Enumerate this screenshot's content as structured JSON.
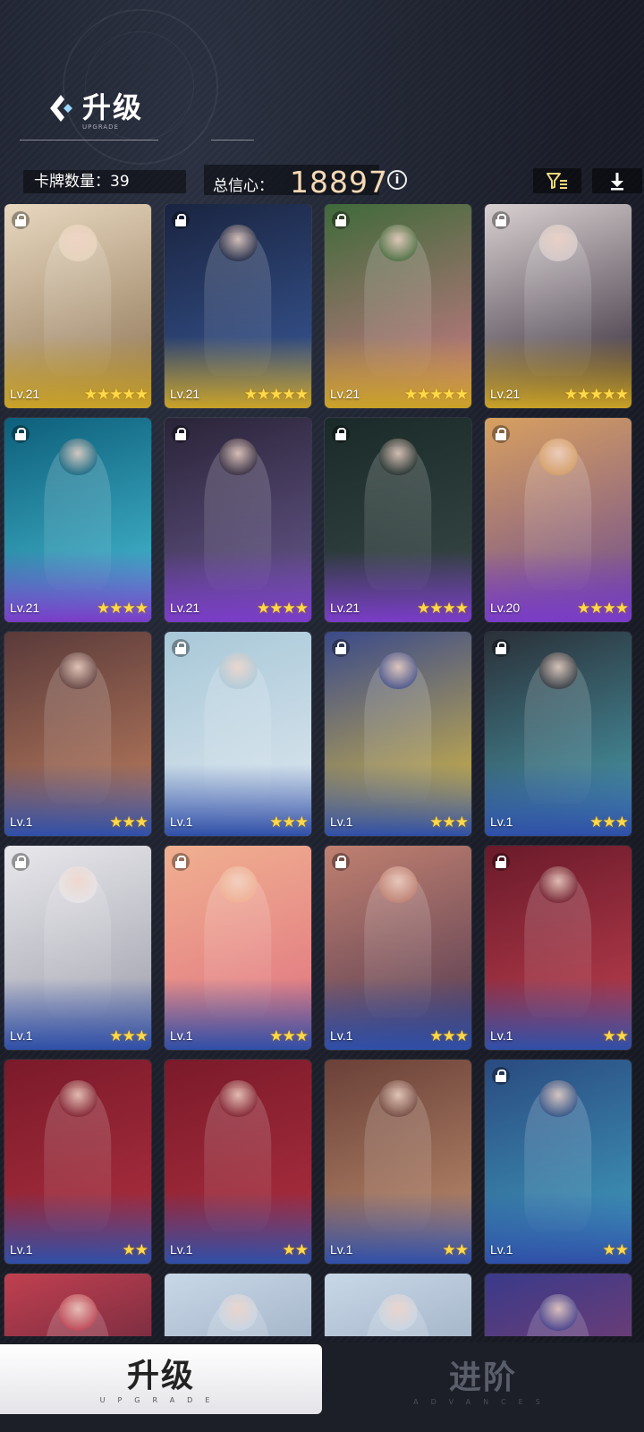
{
  "header": {
    "title": "升级",
    "subtitle": "UPGRADE"
  },
  "stats": {
    "card_count_label": "卡牌数量：",
    "card_count": "39",
    "total_label": "总信心：",
    "total_value": "18897"
  },
  "toolbar": {
    "info_icon": "info-icon",
    "filter_icon": "filter-icon",
    "download_icon": "download-icon"
  },
  "cards": [
    {
      "level": "Lv.21",
      "stars": 5,
      "locked": true
    },
    {
      "level": "Lv.21",
      "stars": 5,
      "locked": true
    },
    {
      "level": "Lv.21",
      "stars": 5,
      "locked": true
    },
    {
      "level": "Lv.21",
      "stars": 5,
      "locked": true
    },
    {
      "level": "Lv.21",
      "stars": 4,
      "locked": true
    },
    {
      "level": "Lv.21",
      "stars": 4,
      "locked": true
    },
    {
      "level": "Lv.21",
      "stars": 4,
      "locked": true
    },
    {
      "level": "Lv.20",
      "stars": 4,
      "locked": true
    },
    {
      "level": "Lv.1",
      "stars": 3,
      "locked": false
    },
    {
      "level": "Lv.1",
      "stars": 3,
      "locked": true
    },
    {
      "level": "Lv.1",
      "stars": 3,
      "locked": true
    },
    {
      "level": "Lv.1",
      "stars": 3,
      "locked": true
    },
    {
      "level": "Lv.1",
      "stars": 3,
      "locked": true
    },
    {
      "level": "Lv.1",
      "stars": 3,
      "locked": true
    },
    {
      "level": "Lv.1",
      "stars": 3,
      "locked": true
    },
    {
      "level": "Lv.1",
      "stars": 2,
      "locked": true
    },
    {
      "level": "Lv.1",
      "stars": 2,
      "locked": false
    },
    {
      "level": "Lv.1",
      "stars": 2,
      "locked": false
    },
    {
      "level": "Lv.1",
      "stars": 2,
      "locked": false
    },
    {
      "level": "Lv.1",
      "stars": 2,
      "locked": true
    },
    {
      "level": "",
      "stars": 0,
      "locked": false
    },
    {
      "level": "",
      "stars": 0,
      "locked": false
    },
    {
      "level": "",
      "stars": 0,
      "locked": false
    },
    {
      "level": "",
      "stars": 0,
      "locked": false
    }
  ],
  "tabs": {
    "upgrade_cn": "升级",
    "upgrade_en": "UPGRADE",
    "advances_cn": "进阶",
    "advances_en": "ADVANCES"
  },
  "colors": {
    "five_star_band": "#c9a227",
    "four_star_band": "#7a3cc8",
    "three_star_band": "#2f4fa8",
    "star": "#ffd94a",
    "total_value": "#f6d9b5"
  }
}
